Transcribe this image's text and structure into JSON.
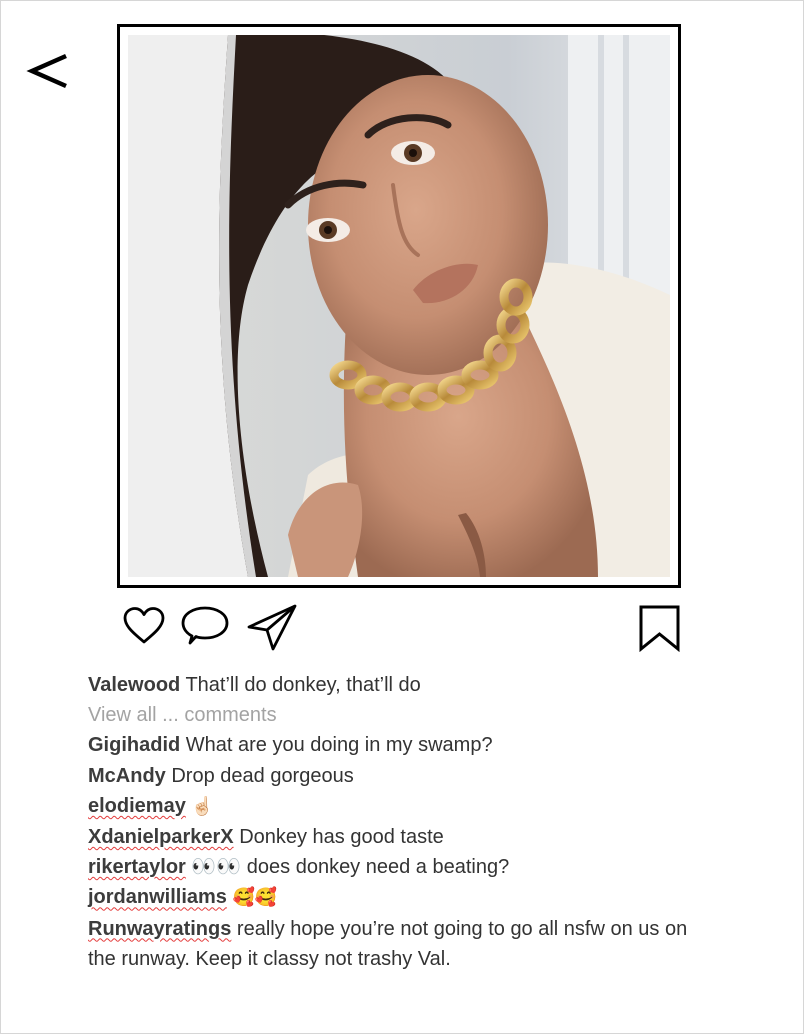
{
  "nav": {
    "back_glyph": "<"
  },
  "post": {
    "image_name": "portrait-photo",
    "actions": {
      "like_icon": "heart-icon",
      "comment_icon": "speech-bubble-icon",
      "share_icon": "paper-plane-icon",
      "save_icon": "bookmark-icon"
    },
    "caption": {
      "user": "Valewood",
      "text": "That’ll do donkey, that’ll do"
    },
    "view_all_label": "View all ... comments",
    "comments": [
      {
        "user": "Gigihadid",
        "text": "What are you doing in my swamp?",
        "underlined": false
      },
      {
        "user": "McAndy",
        "text": "Drop dead gorgeous",
        "underlined": false
      },
      {
        "user": "elodiemay",
        "text": "☝🏻",
        "underlined": true
      },
      {
        "user": "XdanielparkerX",
        "text": "Donkey has good taste",
        "underlined": true
      },
      {
        "user": "rikertaylor",
        "text": "👀👀 does donkey need a beating?",
        "underlined": true
      },
      {
        "user": "jordanwilliams",
        "text": "🥰🥰",
        "underlined": true
      },
      {
        "user": "Runwayratings",
        "text": "really hope you’re not going to go all nsfw on us on the runway. Keep it classy not trashy Val.",
        "underlined": true
      }
    ]
  },
  "colors": {
    "text": "#333333",
    "username": "#3c3c3c",
    "muted": "#a3a3a3",
    "frame": "#000000",
    "spellcheck": "#e33b3b"
  }
}
